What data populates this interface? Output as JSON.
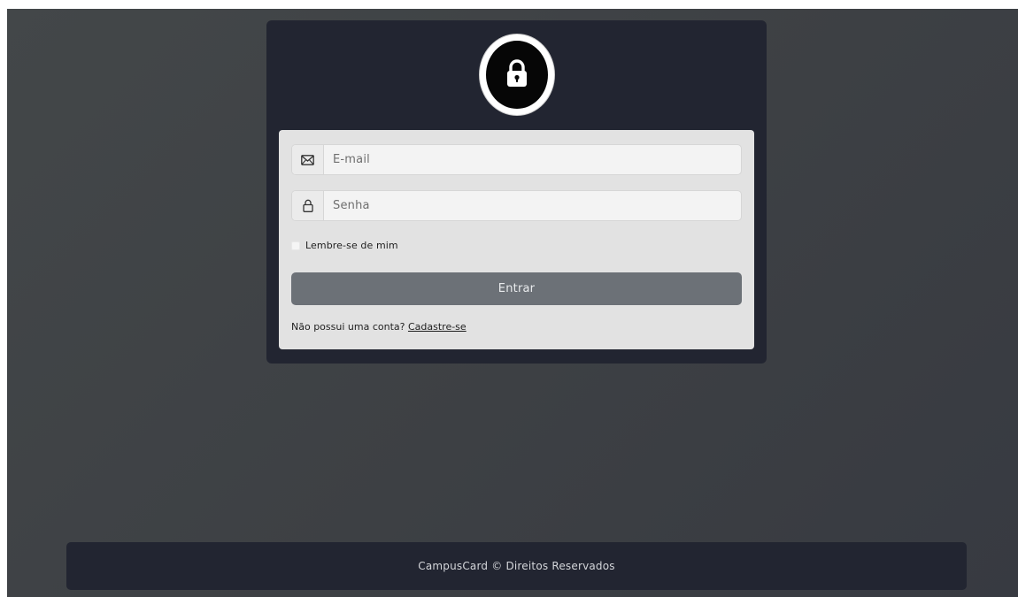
{
  "login": {
    "email_placeholder": "E-mail",
    "password_placeholder": "Senha",
    "remember_label": "Lembre-se de mim",
    "submit_label": "Entrar",
    "signup_prompt": "Não possui uma conta?",
    "signup_link": "Cadastre-se",
    "icons": {
      "avatar": "lock-icon",
      "email": "envelope-icon",
      "password": "lock-icon"
    }
  },
  "footer": {
    "text": "CampusCard © Direitos Reservados"
  },
  "colors": {
    "background": "#3d4044",
    "card": "#222531",
    "panel": "#e2e2e2",
    "button": "#6c7177",
    "footer": "#222531"
  }
}
